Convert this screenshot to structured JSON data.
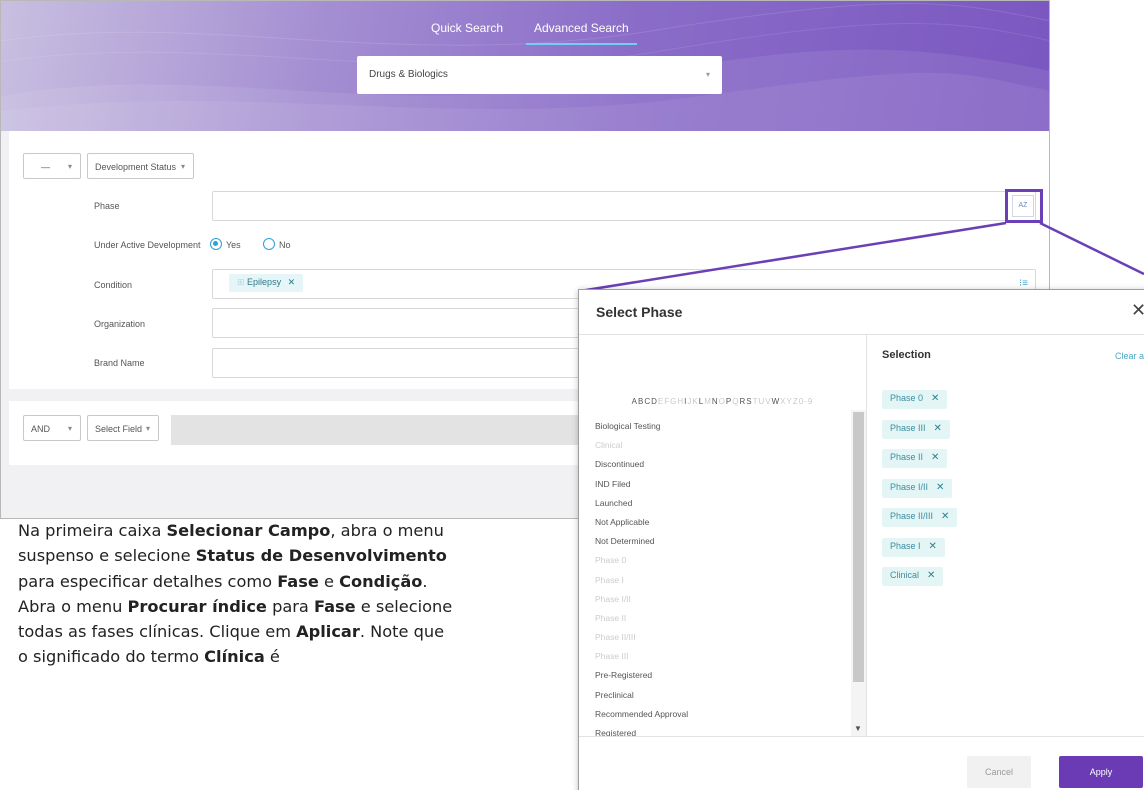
{
  "tabs": {
    "quick": "Quick Search",
    "advanced": "Advanced Search"
  },
  "database_select": {
    "value": "Drugs & Biologics"
  },
  "query": {
    "row1_operator": "—",
    "row1_field": "Development Status",
    "row2_operator": "AND",
    "row2_field": "Select Field",
    "dropdown_glyph": "▾"
  },
  "form": {
    "phase_label": "Phase",
    "phase_button": "AZ",
    "under_active_label": "Under Active Development",
    "yes_label": "Yes",
    "no_label": "No",
    "condition_label": "Condition",
    "condition_chip": "Epilepsy",
    "organization_label": "Organization",
    "brand_label": "Brand Name"
  },
  "dialog": {
    "title": "Select Phase",
    "close": "✕",
    "selection_title": "Selection",
    "clear_all": "Clear all",
    "cancel": "Cancel",
    "apply": "Apply",
    "remove_glyph": "✕",
    "alphabet": [
      {
        "l": "A",
        "on": true
      },
      {
        "l": "B",
        "on": true
      },
      {
        "l": "C",
        "on": true
      },
      {
        "l": "D",
        "on": true
      },
      {
        "l": "E",
        "on": false
      },
      {
        "l": "F",
        "on": false
      },
      {
        "l": "G",
        "on": false
      },
      {
        "l": "H",
        "on": false
      },
      {
        "l": "I",
        "on": true
      },
      {
        "l": "J",
        "on": false
      },
      {
        "l": "K",
        "on": false
      },
      {
        "l": "L",
        "on": true
      },
      {
        "l": "M",
        "on": false
      },
      {
        "l": "N",
        "on": true
      },
      {
        "l": "O",
        "on": false
      },
      {
        "l": "P",
        "on": true
      },
      {
        "l": "Q",
        "on": false
      },
      {
        "l": "R",
        "on": true
      },
      {
        "l": "S",
        "on": true
      },
      {
        "l": "T",
        "on": false
      },
      {
        "l": "U",
        "on": false
      },
      {
        "l": "V",
        "on": false
      },
      {
        "l": "W",
        "on": true
      },
      {
        "l": "X",
        "on": false
      },
      {
        "l": "Y",
        "on": false
      },
      {
        "l": "Z",
        "on": false
      },
      {
        "l": "0-9",
        "on": false
      }
    ],
    "list": [
      {
        "label": "Biological Testing",
        "enabled": true
      },
      {
        "label": "Clinical",
        "enabled": false
      },
      {
        "label": "Discontinued",
        "enabled": true
      },
      {
        "label": "IND Filed",
        "enabled": true
      },
      {
        "label": "Launched",
        "enabled": true
      },
      {
        "label": "Not Applicable",
        "enabled": true
      },
      {
        "label": "Not Determined",
        "enabled": true
      },
      {
        "label": "Phase 0",
        "enabled": false
      },
      {
        "label": "Phase I",
        "enabled": false
      },
      {
        "label": "Phase I/II",
        "enabled": false
      },
      {
        "label": "Phase II",
        "enabled": false
      },
      {
        "label": "Phase II/III",
        "enabled": false
      },
      {
        "label": "Phase III",
        "enabled": false
      },
      {
        "label": "Pre-Registered",
        "enabled": true
      },
      {
        "label": "Preclinical",
        "enabled": true
      },
      {
        "label": "Recommended Approval",
        "enabled": true
      },
      {
        "label": "Registered",
        "enabled": true
      }
    ],
    "selection": [
      "Phase 0",
      "Phase III",
      "Phase II",
      "Phase I/II",
      "Phase II/III",
      "Phase I",
      "Clinical"
    ]
  },
  "instructions": [
    {
      "t": "Na primeira  caixa ",
      "b": false
    },
    {
      "t": "Selecionar Campo",
      "b": true
    },
    {
      "t": ", abra o menu suspenso e selecione ",
      "b": false
    },
    {
      "t": "Status de Desenvolvimento",
      "b": true
    },
    {
      "t": " para especificar detalhes como ",
      "b": false
    },
    {
      "t": "Fase",
      "b": true
    },
    {
      "t": " e ",
      "b": false
    },
    {
      "t": "Condição",
      "b": true
    },
    {
      "t": ". Abra o  menu ",
      "b": false
    },
    {
      "t": "Procurar índice",
      "b": true
    },
    {
      "t": " para ",
      "b": false
    },
    {
      "t": "Fase",
      "b": true
    },
    {
      "t": " e selecione todas as fases clínicas. Clique em ",
      "b": false
    },
    {
      "t": "Aplicar",
      "b": true
    },
    {
      "t": ". Note que o significado do termo ",
      "b": false
    },
    {
      "t": "Clínica",
      "b": true
    },
    {
      "t": " é",
      "b": false
    }
  ],
  "colors": {
    "accent_purple": "#6a3bb4",
    "teal": "#2aa3d8",
    "chip_bg": "#e4f5f5"
  }
}
